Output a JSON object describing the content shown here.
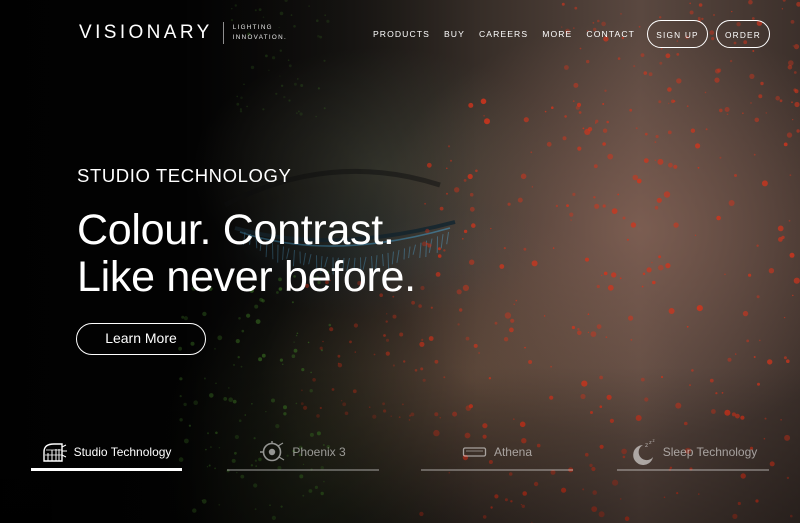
{
  "brand": {
    "name": "VISIONARY",
    "tagline_line1": "LIGHTING",
    "tagline_line2": "INNOVATION."
  },
  "nav": {
    "links": [
      "PRODUCTS",
      "BUY",
      "CAREERS",
      "MORE",
      "CONTACT"
    ],
    "signup_label": "SIGN UP",
    "order_label": "ORDER"
  },
  "hero": {
    "eyebrow": "STUDIO TECHNOLOGY",
    "headline_line1": "Colour. Contrast.",
    "headline_line2": "Like never before.",
    "cta_label": "Learn More"
  },
  "tabs": [
    {
      "label": "Studio Technology",
      "icon": "studio-icon",
      "active": true
    },
    {
      "label": "Phoenix 3",
      "icon": "phoenix-icon",
      "active": false
    },
    {
      "label": "Athena",
      "icon": "athena-icon",
      "active": false
    },
    {
      "label": "Sleep Technology",
      "icon": "sleep-moon-icon",
      "active": false
    }
  ],
  "colors": {
    "text": "#ffffff",
    "background": "#050505",
    "paint_red": "#d2341c",
    "paint_green": "#4a8f2c",
    "eyelash_blue": "#4aa6d6"
  }
}
